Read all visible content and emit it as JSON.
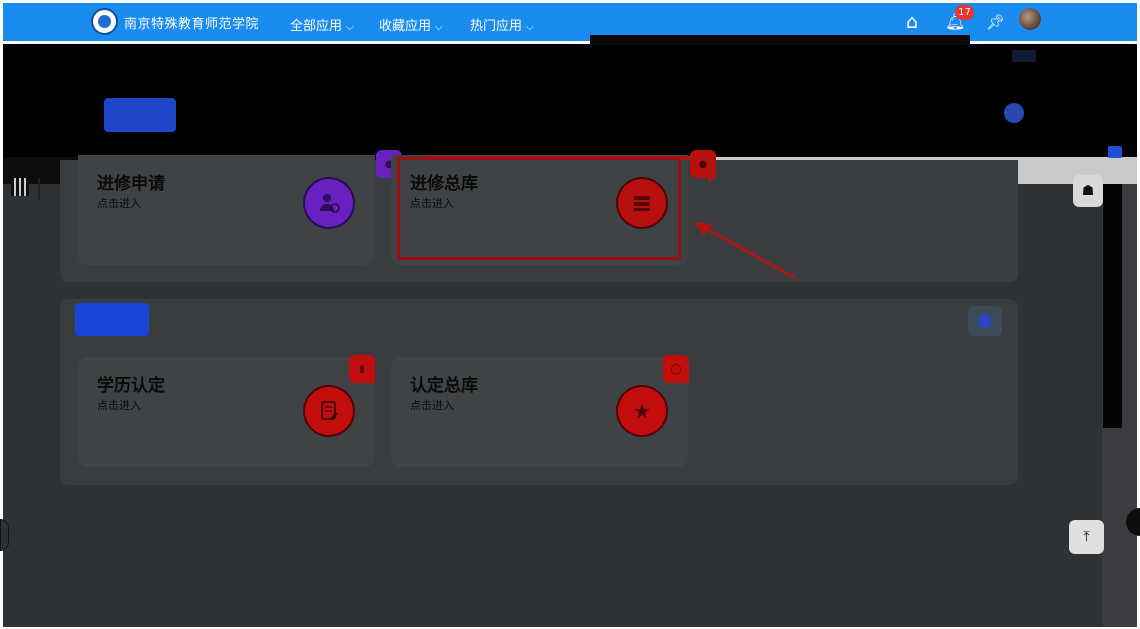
{
  "header": {
    "school_name": "南京特殊教育师范学院",
    "menus": [
      {
        "label": "全部应用",
        "chevron": "⌵"
      },
      {
        "label": "收藏应用",
        "chevron": "⌵"
      },
      {
        "label": "热门应用",
        "chevron": "⌵"
      }
    ],
    "icons": {
      "home": "⌂",
      "bell": "🔔︎",
      "pin": "📌︎"
    },
    "notification_count": "17"
  },
  "sections": [
    {
      "cards": [
        {
          "title": "进修申请",
          "subtitle": "点击进入",
          "icon_color": "#6a1fc0",
          "tab_color": "#6a1fc0"
        },
        {
          "title": "进修总库",
          "subtitle": "点击进入",
          "icon_color": "#b80f0f",
          "tab_color": "#b80f0f"
        }
      ]
    },
    {
      "cards": [
        {
          "title": "学历认定",
          "subtitle": "点击进入",
          "icon_color": "#c40e0e",
          "tab_color": "#c40e0e"
        },
        {
          "title": "认定总库",
          "subtitle": "点击进入",
          "icon_color": "#c40e0e",
          "tab_color": "#c40e0e"
        }
      ]
    }
  ],
  "colors": {
    "topbar": "#1a8cf0",
    "content_bg": "#2f3235",
    "annotation": "#b01414"
  }
}
